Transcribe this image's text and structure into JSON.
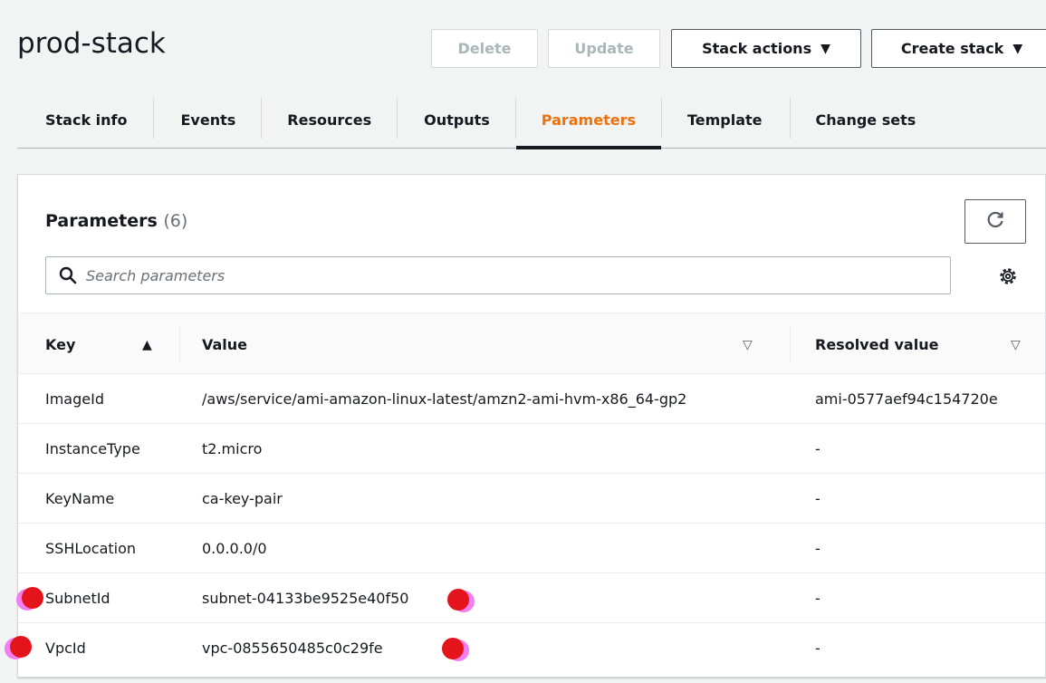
{
  "header": {
    "stack_name": "prod-stack",
    "buttons": {
      "delete": "Delete",
      "update": "Update",
      "stack_actions": "Stack actions",
      "create_stack": "Create stack"
    }
  },
  "tabs": [
    {
      "label": "Stack info",
      "active": false
    },
    {
      "label": "Events",
      "active": false
    },
    {
      "label": "Resources",
      "active": false
    },
    {
      "label": "Outputs",
      "active": false
    },
    {
      "label": "Parameters",
      "active": true
    },
    {
      "label": "Template",
      "active": false
    },
    {
      "label": "Change sets",
      "active": false
    }
  ],
  "panel": {
    "title": "Parameters",
    "count": "(6)",
    "search_placeholder": "Search parameters"
  },
  "table": {
    "columns": {
      "key": "Key",
      "value": "Value",
      "resolved": "Resolved value"
    },
    "rows": [
      {
        "key": "ImageId",
        "value": "/aws/service/ami-amazon-linux-latest/amzn2-ami-hvm-x86_64-gp2",
        "resolved": "ami-0577aef94c154720e"
      },
      {
        "key": "InstanceType",
        "value": "t2.micro",
        "resolved": "-"
      },
      {
        "key": "KeyName",
        "value": "ca-key-pair",
        "resolved": "-"
      },
      {
        "key": "SSHLocation",
        "value": "0.0.0.0/0",
        "resolved": "-"
      },
      {
        "key": "SubnetId",
        "value": "subnet-04133be9525e40f50",
        "resolved": "-"
      },
      {
        "key": "VpcId",
        "value": "vpc-0855650485c0c29fe",
        "resolved": "-"
      }
    ]
  },
  "colors": {
    "active_tab": "#ec7211",
    "marker_red": "#e3141c",
    "marker_pink": "#f47ef0"
  }
}
